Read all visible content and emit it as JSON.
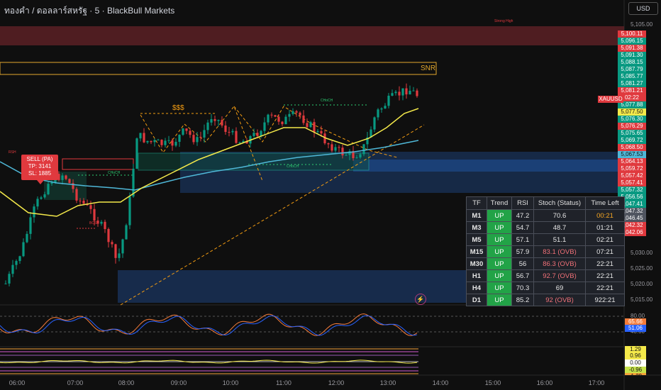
{
  "header": {
    "title": "ทองคำ / ดอลลาร์สหรัฐ · 5 · BlackBull Markets",
    "currency_button": "USD"
  },
  "price_axis": {
    "ticks": [
      "5,105.00",
      "5,030.00",
      "5,025.00",
      "5,020.00",
      "5,015.00"
    ],
    "tags": [
      {
        "text": "5,100.11",
        "color": "#e0393e"
      },
      {
        "text": "5,096.15",
        "color": "#089981"
      },
      {
        "text": "5,091.38",
        "color": "#e0393e"
      },
      {
        "text": "5,091.30",
        "color": "#089981"
      },
      {
        "text": "5,088.15",
        "color": "#089981"
      },
      {
        "text": "5,087.79",
        "color": "#089981"
      },
      {
        "text": "5,085.77",
        "color": "#089981"
      },
      {
        "text": "5,081.27",
        "color": "#089981"
      },
      {
        "text": "5,081.21",
        "color": "#e0393e"
      },
      {
        "text": "02:22",
        "color": "#e0393e"
      },
      {
        "text": "5,077.88",
        "color": "#089981"
      },
      {
        "text": "5,077.50",
        "color": "#f4e94a",
        "dark": true
      },
      {
        "text": "5,076.30",
        "color": "#089981"
      },
      {
        "text": "5,076.29",
        "color": "#e0393e"
      },
      {
        "text": "5,075.65",
        "color": "#089981"
      },
      {
        "text": "5,069.72",
        "color": "#089981"
      },
      {
        "text": "5,068.50",
        "color": "#e0393e"
      },
      {
        "text": "5,067.53",
        "color": "#4fb8d8",
        "dark": true
      },
      {
        "text": "5,064.13",
        "color": "#e0393e"
      },
      {
        "text": "5,059.72",
        "color": "#e0393e"
      },
      {
        "text": "5,057.42",
        "color": "#e0393e"
      },
      {
        "text": "5,057.41",
        "color": "#e0393e"
      },
      {
        "text": "5,057.32",
        "color": "#089981"
      },
      {
        "text": "5,056.56",
        "color": "#089981"
      },
      {
        "text": "5,047.41",
        "color": "#089981"
      },
      {
        "text": "5,047.32",
        "color": "#505560"
      },
      {
        "text": "5,046.45",
        "color": "#505560"
      },
      {
        "text": "5,042.32",
        "color": "#e0393e"
      },
      {
        "text": "5,042.06",
        "color": "#e0393e"
      }
    ],
    "symbol_tag": "XAUUSD"
  },
  "time_axis": [
    "06:00",
    "07:00",
    "08:00",
    "09:00",
    "10:00",
    "11:00",
    "12:00",
    "13:00",
    "14:00",
    "15:00",
    "16:00",
    "17:00"
  ],
  "annotations": {
    "sell_box": [
      "SELL (PA)",
      "TP: 3141",
      "SL: 1885"
    ],
    "snr": "SNR",
    "sss": "$$$",
    "strong_high": "Strong High",
    "choch_1": "CHoCH",
    "choch_2": "CHoCH",
    "choch_3": "CHoCH",
    "bos": "BOS",
    "rsh": "RSH"
  },
  "table": {
    "headers": [
      "TF",
      "Trend",
      "RSI",
      "Stoch (Status)",
      "Time Left"
    ],
    "rows": [
      {
        "tf": "M1",
        "trend": "UP",
        "rsi": "47.2",
        "stoch": "70.6",
        "stoch_color": "#e6e6e6",
        "time": "00:21",
        "time_color": "#f5a623"
      },
      {
        "tf": "M3",
        "trend": "UP",
        "rsi": "54.7",
        "stoch": "48.7",
        "stoch_color": "#e6e6e6",
        "time": "01:21",
        "time_color": "#e6e6e6"
      },
      {
        "tf": "M5",
        "trend": "UP",
        "rsi": "57.1",
        "stoch": "51.1",
        "stoch_color": "#e6e6e6",
        "time": "02:21",
        "time_color": "#e6e6e6"
      },
      {
        "tf": "M15",
        "trend": "UP",
        "rsi": "57.9",
        "stoch": "83.1 (OVB)",
        "stoch_color": "#f07178",
        "time": "07:21",
        "time_color": "#e6e6e6"
      },
      {
        "tf": "M30",
        "trend": "UP",
        "rsi": "56",
        "stoch": "86.3 (OVB)",
        "stoch_color": "#f07178",
        "time": "22:21",
        "time_color": "#e6e6e6"
      },
      {
        "tf": "H1",
        "trend": "UP",
        "rsi": "56.7",
        "stoch": "92.7 (OVB)",
        "stoch_color": "#f07178",
        "time": "22:21",
        "time_color": "#e6e6e6"
      },
      {
        "tf": "H4",
        "trend": "UP",
        "rsi": "70.3",
        "stoch": "69",
        "stoch_color": "#e6e6e6",
        "time": "22:21",
        "time_color": "#e6e6e6"
      },
      {
        "tf": "D1",
        "trend": "UP",
        "rsi": "85.2",
        "stoch": "92 (OVB)",
        "stoch_color": "#f07178",
        "time": "922:21",
        "time_color": "#e6e6e6"
      }
    ]
  },
  "stoch_panel": {
    "ticks": [
      "80.00",
      "40.00"
    ],
    "tags": [
      {
        "text": "65.66",
        "color": "#f57c3a"
      },
      {
        "text": "51.06",
        "color": "#2962ff"
      }
    ]
  },
  "lower_panel": {
    "tags": [
      {
        "text": "1.29",
        "color": "#f4e94a",
        "dark": true
      },
      {
        "text": "0.96",
        "color": "#f4e94a",
        "dark": true
      },
      {
        "text": "0.00",
        "color": "#ffffff",
        "dark": true
      },
      {
        "text": "-0.96",
        "color": "#c6e24a",
        "dark": true
      },
      {
        "text": "-1.29",
        "color": "#f4a23a",
        "dark": true
      }
    ]
  },
  "colors": {
    "up": "#089981",
    "down": "#e0393e",
    "ema_fast": "#f4e94a",
    "ema_slow": "#4fb8d8",
    "zone_blue": "#1b3a6b",
    "zone_red": "#5a2024"
  }
}
